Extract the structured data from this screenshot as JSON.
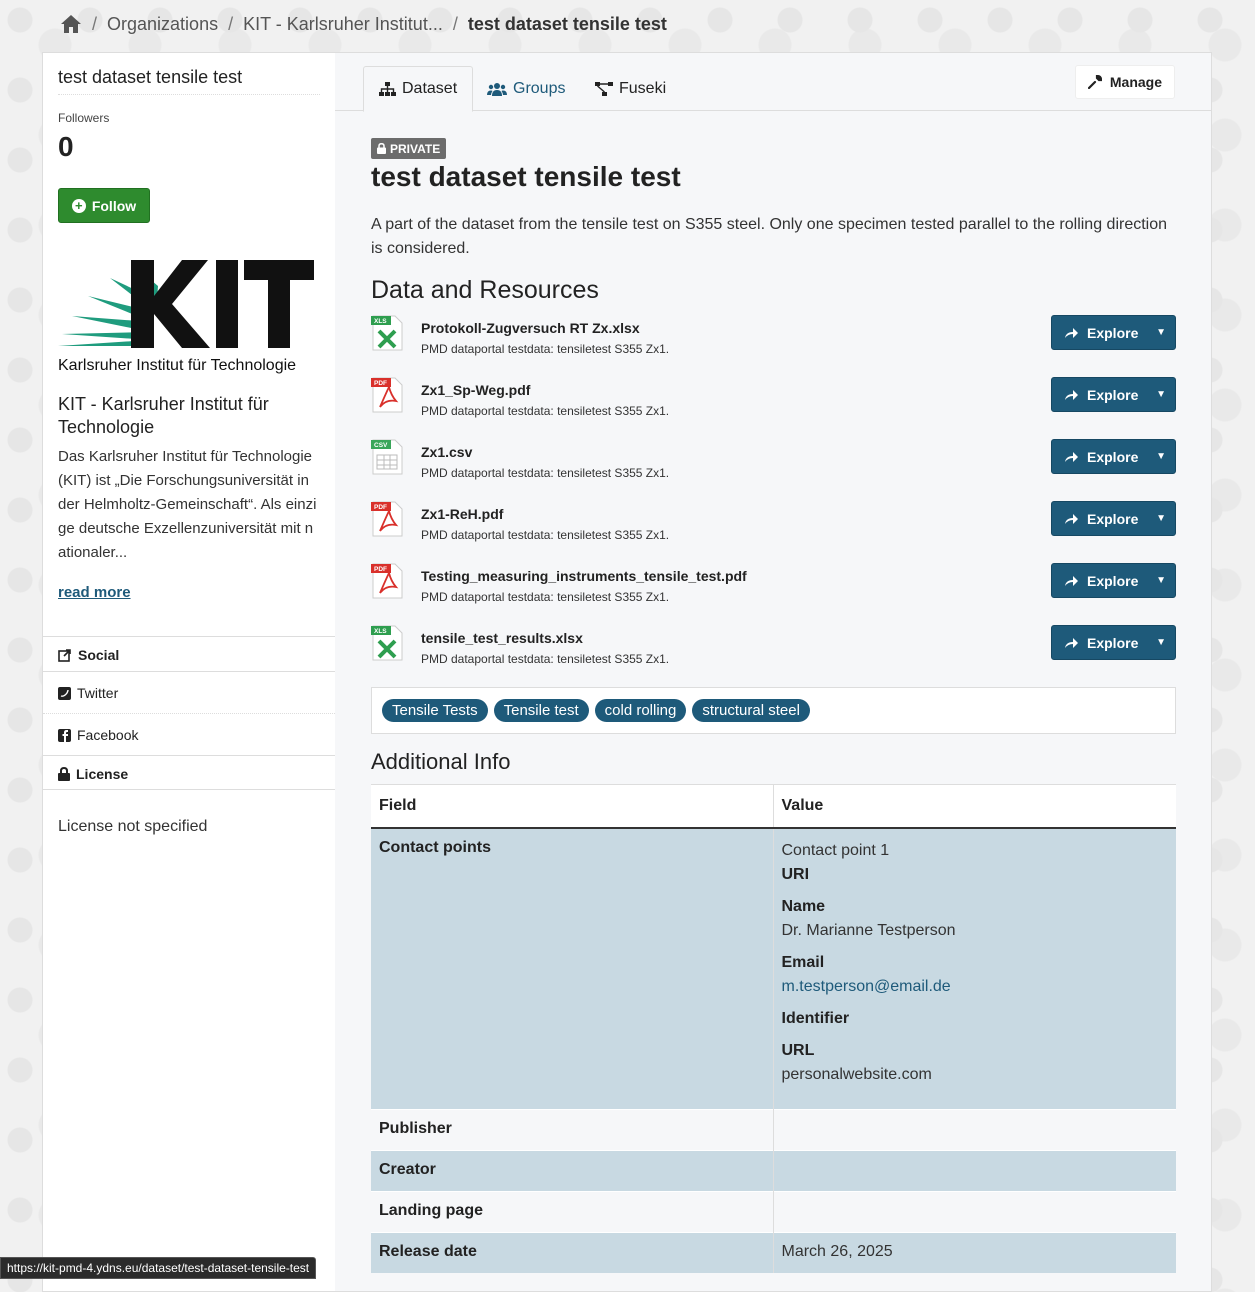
{
  "breadcrumb": {
    "home_icon": "home-icon",
    "items": [
      "Organizations",
      "KIT - Karlsruher Institut...",
      "test dataset tensile test"
    ],
    "separator": "/"
  },
  "sidebar": {
    "title": "test dataset tensile test",
    "followers_label": "Followers",
    "followers_count": "0",
    "follow_label": "Follow",
    "logo_caption": "Karlsruher Institut für Technologie",
    "org_name": "KIT - Karlsruher Institut für Technologie",
    "org_description": "Das Karlsruher Institut für Technologie (KIT) ist „Die Forschungsuniversität in der Helmholtz-Gemeinschaft“. Als einzige deutsche Exzellenzuniversität mit nationaler...",
    "read_more": "read more",
    "social_label": "Social",
    "twitter_label": "Twitter",
    "facebook_label": "Facebook",
    "license_label": "License",
    "license_text": "License not specified"
  },
  "tabs": {
    "dataset": "Dataset",
    "groups": "Groups",
    "fuseki": "Fuseki",
    "manage": "Manage"
  },
  "dataset": {
    "badge": "PRIVATE",
    "title": "test dataset tensile test",
    "description": "A part of the dataset from the tensile test on S355 steel. Only one specimen tested parallel to the rolling direction is considered."
  },
  "resources": {
    "heading": "Data and Resources",
    "explore_label": "Explore",
    "items": [
      {
        "name": "Protokoll-Zugversuch RT Zx.xlsx",
        "desc": "PMD dataportal testdata: tensiletest S355 Zx1.",
        "format": "XLS",
        "color": "#2e9e4f"
      },
      {
        "name": "Zx1_Sp-Weg.pdf",
        "desc": "PMD dataportal testdata: tensiletest S355 Zx1.",
        "format": "PDF",
        "color": "#d9302b"
      },
      {
        "name": "Zx1.csv",
        "desc": "PMD dataportal testdata: tensiletest S355 Zx1.",
        "format": "CSV",
        "color": "#3aa65a"
      },
      {
        "name": "Zx1-ReH.pdf",
        "desc": "PMD dataportal testdata: tensiletest S355 Zx1.",
        "format": "PDF",
        "color": "#d9302b"
      },
      {
        "name": "Testing_measuring_instruments_tensile_test.pdf",
        "desc": "PMD dataportal testdata: tensiletest S355 Zx1.",
        "format": "PDF",
        "color": "#d9302b"
      },
      {
        "name": "tensile_test_results.xlsx",
        "desc": "PMD dataportal testdata: tensiletest S355 Zx1.",
        "format": "XLS",
        "color": "#2e9e4f"
      }
    ]
  },
  "tags": [
    "Tensile Tests",
    "Tensile test",
    "cold rolling",
    "structural steel"
  ],
  "additional_info": {
    "heading": "Additional Info",
    "col_field": "Field",
    "col_value": "Value",
    "contact": {
      "field": "Contact points",
      "title": "Contact point 1",
      "uri_label": "URI",
      "name_label": "Name",
      "name_value": "Dr. Marianne Testperson",
      "email_label": "Email",
      "email_value": "m.testperson@email.de",
      "identifier_label": "Identifier",
      "url_label": "URL",
      "url_value": "personalwebsite.com"
    },
    "rows": [
      {
        "field": "Publisher",
        "value": ""
      },
      {
        "field": "Creator",
        "value": ""
      },
      {
        "field": "Landing page",
        "value": ""
      },
      {
        "field": "Release date",
        "value": "March 26, 2025"
      }
    ]
  },
  "status_url": "https://kit-pmd-4.ydns.eu/dataset/test-dataset-tensile-test",
  "colors": {
    "accent": "#1e5a7a",
    "follow": "#2e8b2e",
    "kit_green": "#1f9c7e"
  }
}
